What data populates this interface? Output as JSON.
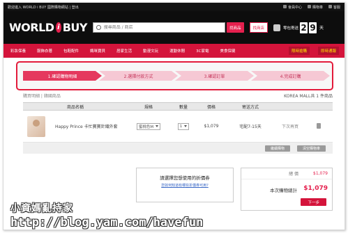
{
  "topbar": {
    "left_text": "歡迎進入 WORLD i BUY 國際購物網站 | 登出",
    "links": [
      "會員中心",
      "購物車",
      "客服"
    ]
  },
  "header": {
    "logo_left": "WORLD",
    "logo_mid": "i",
    "logo_right": "BUY",
    "search_placeholder": "搜尋商品 / 商店",
    "search_button": "找商品",
    "buy_button": "找商店",
    "shipping_label": "零包寄送",
    "shipping_days": [
      "2",
      "9"
    ],
    "shipping_unit": "天"
  },
  "nav": {
    "items": [
      "彩妝保養",
      "服飾衣著",
      "包鞋配件",
      "媽咪寶貝",
      "居家生活",
      "動漫文玩",
      "運動休閒",
      "3C家電",
      "美食保健"
    ],
    "right_items": [
      "限時搶購",
      "即時通報"
    ]
  },
  "steps": [
    {
      "label": "1.確認購物明細",
      "active": true
    },
    {
      "label": "2.選擇付款方式",
      "active": false
    },
    {
      "label": "3.確認訂單",
      "active": false
    },
    {
      "label": "4.完成訂購",
      "active": false
    }
  ],
  "meta": {
    "left": "購買明細 | 韓國商品",
    "right": "KOREA MALL共 1 件商品"
  },
  "table": {
    "headers": [
      "商品名稱",
      "規格",
      "數量",
      "價格",
      "寄送方式",
      "",
      ""
    ],
    "row": {
      "name": "Happy Prince 卡忙寶寶針織外套",
      "spec": "蜜桃色M",
      "qty": "1",
      "price": "$1,079",
      "shipping": "宅配7-15天",
      "save": "下次再買"
    },
    "actions": [
      "繼續購物",
      "清空購物車"
    ]
  },
  "coupon": {
    "title": "請選擇您想使用的折價券",
    "link": "您如何知道有哪些折價券可用?"
  },
  "summary": {
    "total_label": "總 價",
    "total_value": "$1,079",
    "final_label": "本次購物總計",
    "final_value": "$1,079",
    "next_button": "下一步"
  },
  "watermark": {
    "line1": "小資媽亂持家",
    "line2": "http://blog.yam.com/havefun"
  },
  "colors": {
    "brand_red": "#d4143b",
    "step_active": "#e5395e",
    "step_inactive": "#f6c8d4",
    "price_red": "#e5204e"
  }
}
